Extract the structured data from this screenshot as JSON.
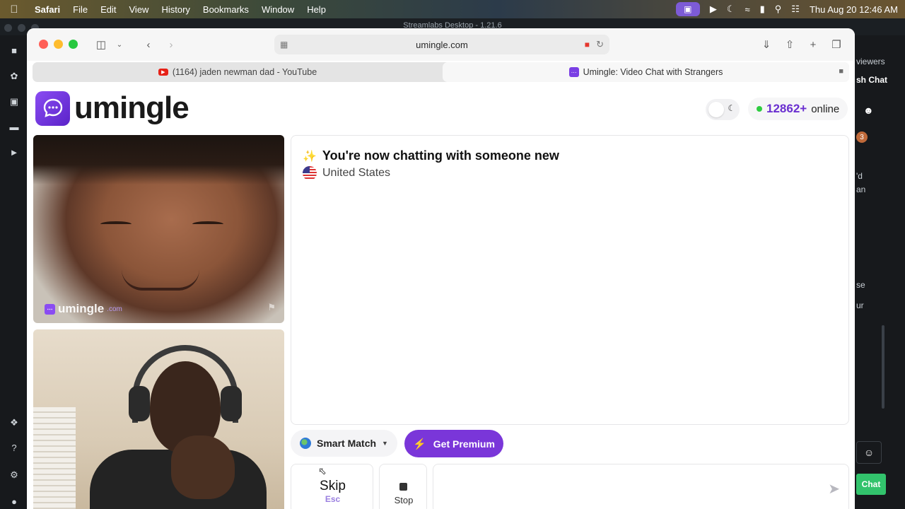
{
  "menubar": {
    "app": "Safari",
    "menus": [
      "File",
      "Edit",
      "View",
      "History",
      "Bookmarks",
      "Window",
      "Help"
    ],
    "clock": "Thu Aug 20  12:46 AM"
  },
  "background_app": {
    "title": "Streamlabs Desktop - 1.21.6",
    "right_texts": [
      "viewers",
      "sh Chat",
      "'d",
      "an",
      "se",
      "ur"
    ],
    "badge": "3",
    "chat_button": "Chat"
  },
  "browser": {
    "url": "umingle.com",
    "tabs": [
      {
        "title": "(1164) jaden newman dad - YouTube"
      },
      {
        "title": "Umingle: Video Chat with Strangers"
      }
    ]
  },
  "site": {
    "logo_text": "umingle",
    "online_count": "12862+",
    "online_label": "online",
    "watermark_text": "umingle",
    "watermark_suffix": ".com"
  },
  "chat": {
    "heading": "You're now chatting with someone new",
    "country": "United States"
  },
  "controls": {
    "smart_match": "Smart Match",
    "premium": "Get Premium",
    "skip_label": "Skip",
    "skip_shortcut": "Esc",
    "stop_label": "Stop",
    "message_placeholder": ""
  },
  "colors": {
    "brand_purple": "#7a36d9",
    "online_dot": "#2ecc40",
    "chat_button": "#32c36c"
  }
}
